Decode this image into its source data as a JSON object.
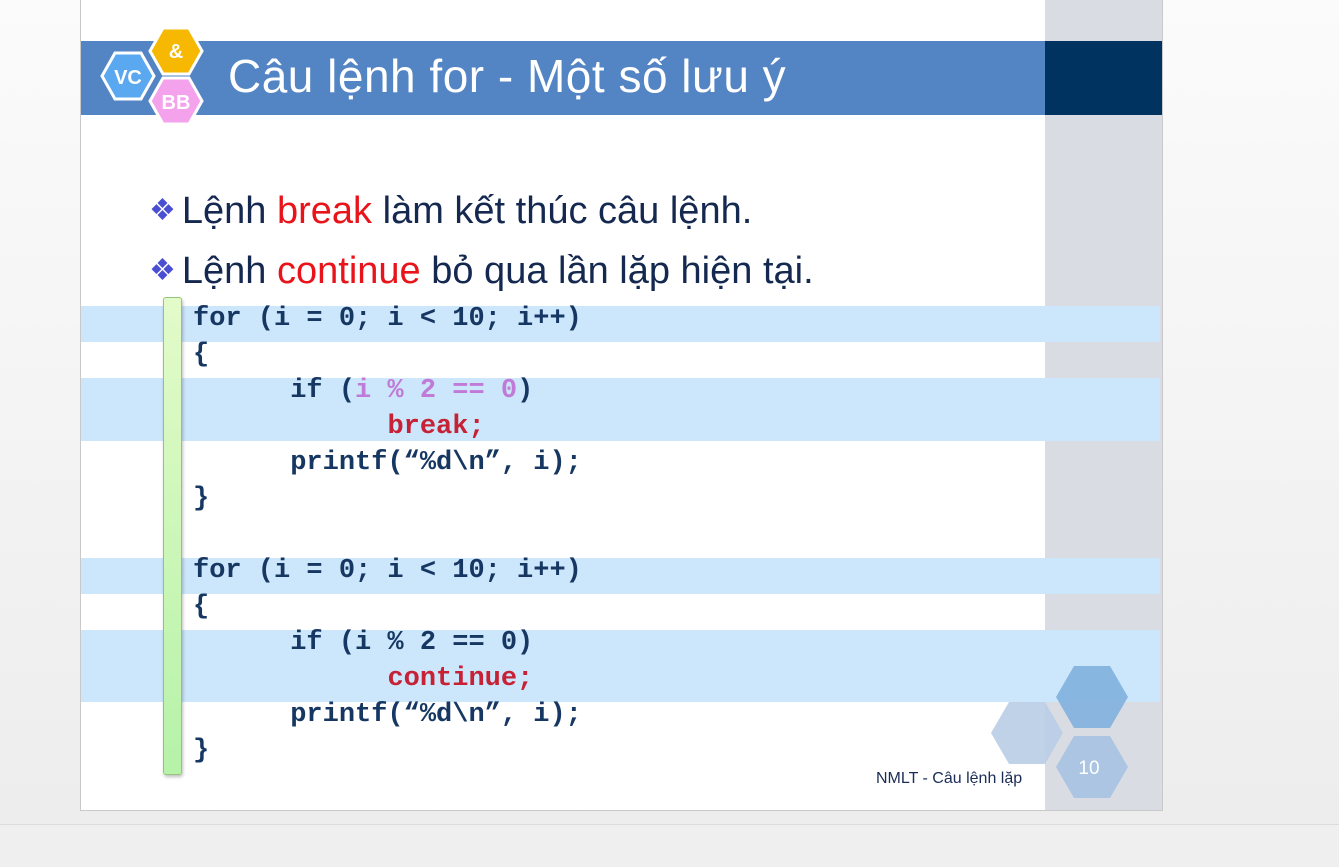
{
  "slide": {
    "title": "Câu lệnh for - Một số lưu ý",
    "logo": {
      "top": "&",
      "left": "VC",
      "bottom": "BB",
      "colors": {
        "top": "#f6b800",
        "left": "#5aa8ef",
        "bottom": "#f4a2ec"
      }
    },
    "bullets": [
      {
        "before": "Lệnh ",
        "keyword": "break",
        "after": " làm kết thúc câu lệnh."
      },
      {
        "before": "Lệnh ",
        "keyword": "continue",
        "after": " bỏ qua lần lặp hiện tại."
      }
    ],
    "code": {
      "block1": {
        "for_line": "for (i = 0; i < 10; i++)",
        "open": "{",
        "if_prefix": "      if (",
        "if_cond": "i % 2 == 0",
        "if_suffix": ")",
        "stmt": "break;",
        "printf": "      printf(“%d\\n”, i);",
        "close": "}"
      },
      "block2": {
        "for_line": "for (i = 0; i < 10; i++)",
        "open": "{",
        "if_line": "      if (i % 2 == 0)",
        "stmt": "continue;",
        "printf": "      printf(“%d\\n”, i);",
        "close": "}"
      }
    },
    "footer": "NMLT - Câu lệnh lặp",
    "page_number": "10",
    "colors": {
      "title_bar": "#5384c4",
      "accent_dark": "#00335f",
      "keyword_red": "#e8141a",
      "code_text": "#173763"
    }
  }
}
